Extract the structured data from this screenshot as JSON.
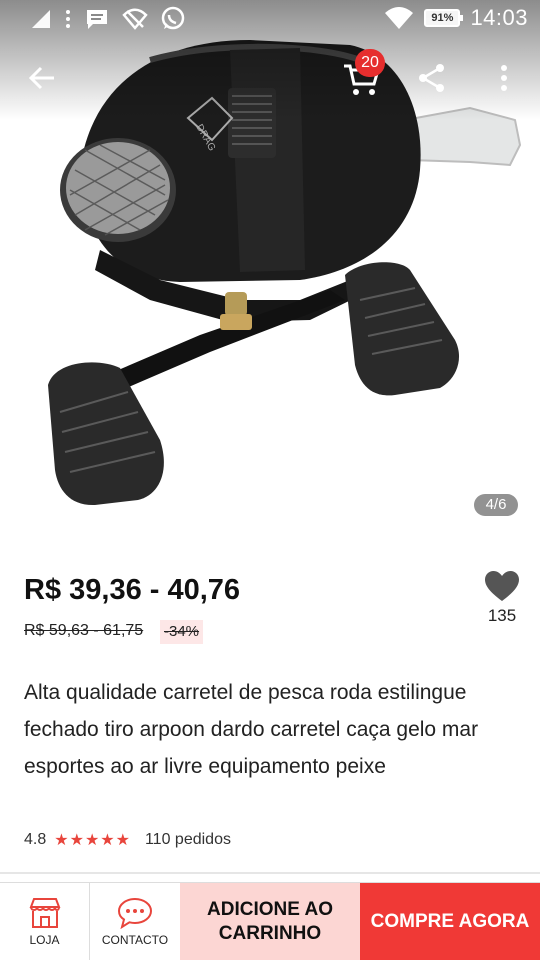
{
  "status_bar": {
    "time": "14:03",
    "battery": "91%",
    "icons": [
      "signal-icon",
      "dots-icon",
      "message-icon",
      "wifi-off-icon",
      "whatsapp-icon",
      "wifi-icon",
      "battery-icon"
    ]
  },
  "top_bar": {
    "cart_count": "20",
    "icons": [
      "back-arrow-icon",
      "cart-icon",
      "share-icon",
      "more-icon"
    ]
  },
  "gallery": {
    "indicator": "4/6"
  },
  "product": {
    "price": "R$ 39,36 - 40,76",
    "original_price": "R$ 59,63 - 61,75",
    "discount": "-34%",
    "wishlist_count": "135",
    "title": "Alta qualidade carretel de pesca roda estilingue fechado tiro arpoon dardo carretel caça gelo mar esportes ao ar livre equipamento peixe",
    "rating": "4.8",
    "stars": "★★★★★",
    "orders": "110 pedidos"
  },
  "bottom_bar": {
    "shop_label": "LOJA",
    "contact_label": "CONTACTO",
    "add_to_cart": "ADICIONE AO CARRINHO",
    "buy_now": "COMPRE AGORA"
  },
  "colors": {
    "accent": "#f03936",
    "cart_button_bg": "#fcd6d3",
    "badge": "#e62e2e",
    "stars": "#e8453c"
  }
}
